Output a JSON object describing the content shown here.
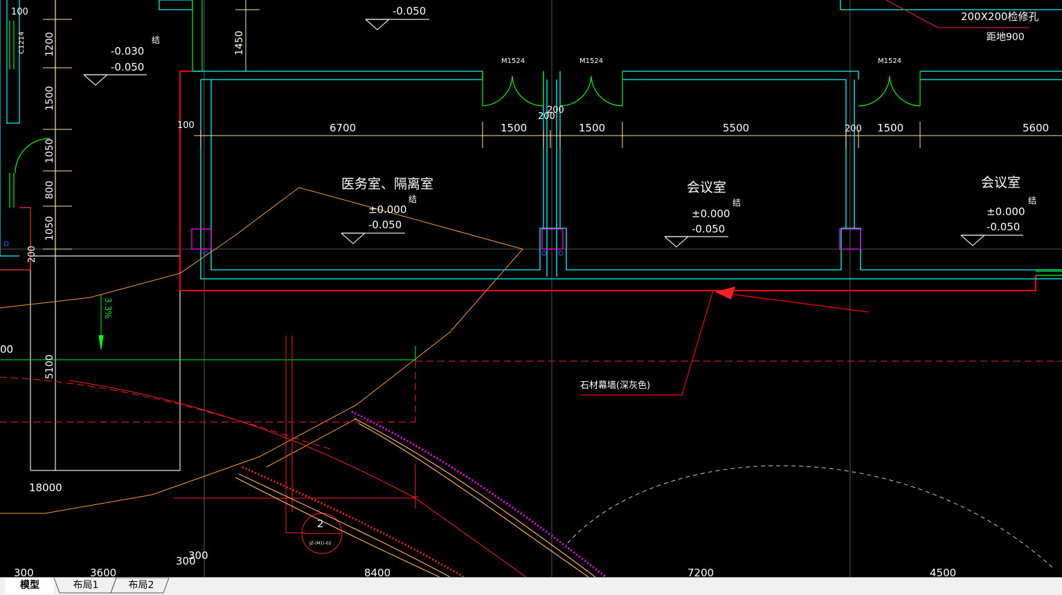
{
  "drawing": {
    "annotations": {
      "access_hole": "200X200检修孔",
      "access_hole_height": "距地900",
      "curtain_wall": "石材幕墙(深灰色)",
      "slope": "3.3%",
      "detail_number": "2",
      "detail_ref": "JZ-(M1)-02",
      "window_tag": "C1214"
    },
    "rooms": [
      {
        "name": "医务室、隔离室",
        "tag": "结",
        "level1": "±0.000",
        "level2": "-0.050"
      },
      {
        "name": "会议室",
        "tag": "结",
        "level1": "±0.000",
        "level2": "-0.050"
      },
      {
        "name": "会议室",
        "tag": "结",
        "level1": "±0.000",
        "level2": "-0.050"
      }
    ],
    "door_tags": [
      "M1524",
      "M1524",
      "M1524"
    ],
    "levels": {
      "top_center": "-0.050",
      "top_left_1": "-0.030",
      "top_left_2": "-0.050",
      "top_left_tag": "结"
    },
    "top_dimensions": [
      "6700",
      "1500",
      "1500",
      "5500",
      "1500",
      "5600"
    ],
    "small_dimensions": [
      "100",
      "200",
      "200",
      "200",
      "100",
      "1450"
    ],
    "left_dimensions": [
      "1200",
      "1500",
      "1050",
      "800",
      "1050",
      "200",
      "5100",
      "18000",
      "100",
      "00"
    ],
    "bottom_dimensions": [
      "300",
      "3600",
      "300",
      "300",
      "8400",
      "7200",
      "4500"
    ]
  },
  "tabs": [
    {
      "label": "模型",
      "active": true
    },
    {
      "label": "布局1",
      "active": false
    },
    {
      "label": "布局2",
      "active": false
    }
  ],
  "colors": {
    "background": "#000000",
    "wall_cyan": "#00ffff",
    "dimension_yellow": "#ffe4a0",
    "curtain_red": "#ff0000",
    "door_green": "#00ff00",
    "column_magenta": "#ff00ff",
    "orange_line": "#ff9933"
  }
}
